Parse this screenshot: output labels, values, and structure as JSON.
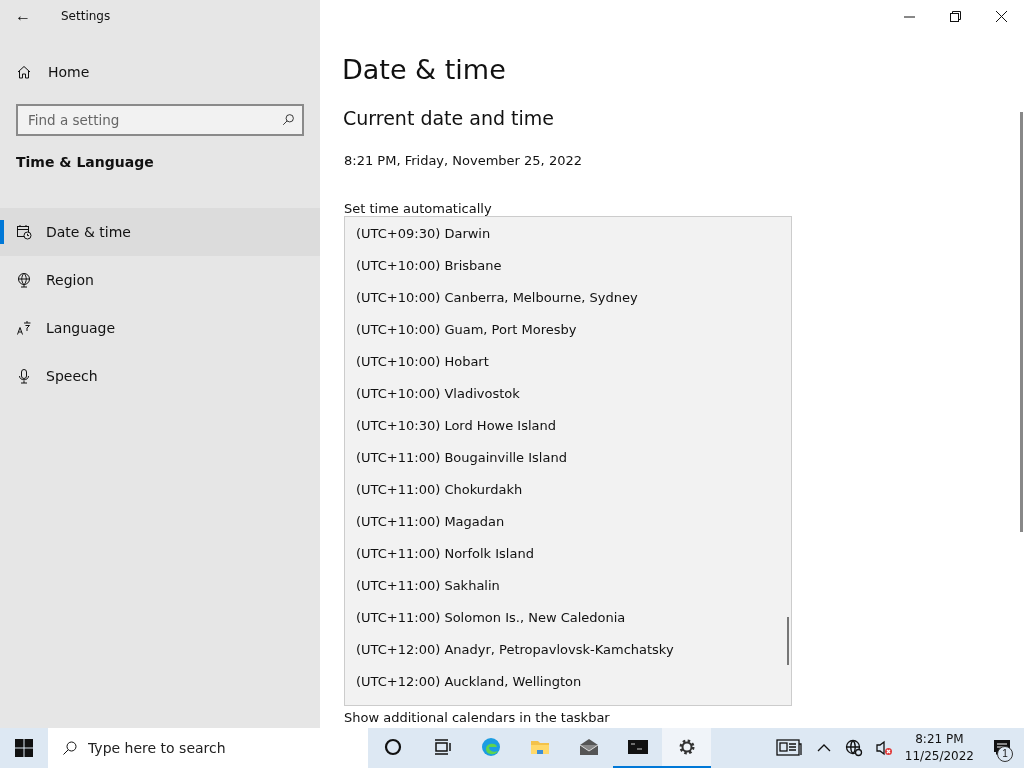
{
  "window": {
    "title": "Settings",
    "back": "←"
  },
  "sidebar": {
    "home": "Home",
    "search": {
      "placeholder": "Find a setting"
    },
    "section": "Time & Language",
    "items": [
      {
        "label": "Date & time",
        "selected": true
      },
      {
        "label": "Region",
        "selected": false
      },
      {
        "label": "Language",
        "selected": false
      },
      {
        "label": "Speech",
        "selected": false
      }
    ]
  },
  "main": {
    "title": "Date & time",
    "heading": "Current date and time",
    "now": "8:21 PM, Friday, November 25, 2022",
    "set_time_label": "Set time automatically",
    "calendars_label": "Show additional calendars in the taskbar"
  },
  "timezone_list": [
    "(UTC+09:30) Darwin",
    "(UTC+10:00) Brisbane",
    "(UTC+10:00) Canberra, Melbourne, Sydney",
    "(UTC+10:00) Guam, Port Moresby",
    "(UTC+10:00) Hobart",
    "(UTC+10:00) Vladivostok",
    "(UTC+10:30) Lord Howe Island",
    "(UTC+11:00) Bougainville Island",
    "(UTC+11:00) Chokurdakh",
    "(UTC+11:00) Magadan",
    "(UTC+11:00) Norfolk Island",
    "(UTC+11:00) Sakhalin",
    "(UTC+11:00) Solomon Is., New Caledonia",
    "(UTC+12:00) Anadyr, Petropavlovsk-Kamchatsky",
    "(UTC+12:00) Auckland, Wellington"
  ],
  "taskbar": {
    "search": {
      "placeholder": "Type here to search"
    },
    "apps": [
      {
        "kind": "cortana",
        "active": false
      },
      {
        "kind": "taskview",
        "active": false
      },
      {
        "kind": "edge",
        "active": false
      },
      {
        "kind": "explorer",
        "active": false
      },
      {
        "kind": "mail",
        "active": false
      },
      {
        "kind": "terminal",
        "active": true
      },
      {
        "kind": "settings",
        "active": true
      }
    ],
    "time": "8:21 PM",
    "date": "11/25/2022",
    "notifications": "1"
  }
}
